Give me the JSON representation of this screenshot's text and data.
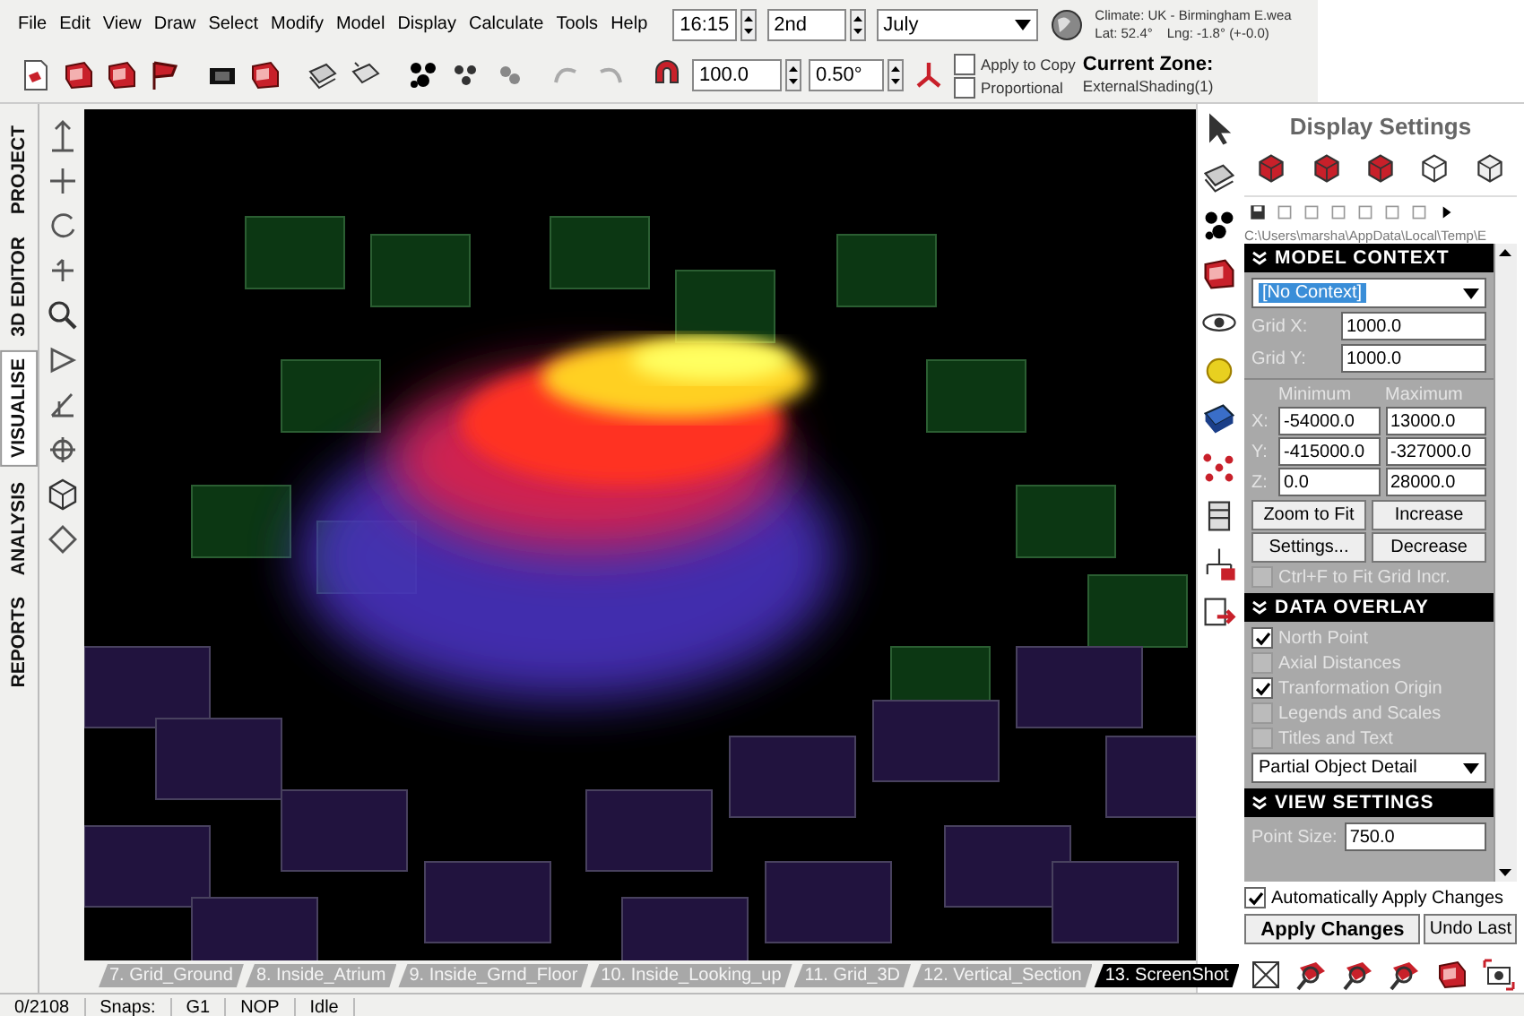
{
  "menu": [
    "File",
    "Edit",
    "View",
    "Draw",
    "Select",
    "Modify",
    "Model",
    "Display",
    "Calculate",
    "Tools",
    "Help"
  ],
  "date_controls": {
    "time": "16:15",
    "day": "2nd",
    "month": "July"
  },
  "climate": {
    "location": "Climate: UK - Birmingham E.wea",
    "lat": "Lat: 52.4°",
    "lng": "Lng: -1.8° (+-0.0)"
  },
  "toolbar": {
    "scale": "100.0",
    "angle": "0.50°",
    "options": [
      {
        "label": "Apply to Copy",
        "checked": false
      },
      {
        "label": "Proportional",
        "checked": false
      }
    ],
    "zone_label": "Current Zone:",
    "zone_value": "ExternalShading(1)"
  },
  "side_tabs": [
    {
      "label": "PROJECT",
      "selected": false
    },
    {
      "label": "3D EDITOR",
      "selected": false
    },
    {
      "label": "VISUALISE",
      "selected": true
    },
    {
      "label": "ANALYSIS",
      "selected": false
    },
    {
      "label": "REPORTS",
      "selected": false
    }
  ],
  "scene_tabs": [
    {
      "label": "7. Grid_Ground",
      "selected": false
    },
    {
      "label": "8. Inside_Atrium",
      "selected": false
    },
    {
      "label": "9. Inside_Grnd_Floor",
      "selected": false
    },
    {
      "label": "10. Inside_Looking_up",
      "selected": false
    },
    {
      "label": "11. Grid_3D",
      "selected": false
    },
    {
      "label": "12. Vertical_Section",
      "selected": false
    },
    {
      "label": "13. ScreenShot",
      "selected": true
    }
  ],
  "display_settings": {
    "title": "Display Settings",
    "path": "C:\\Users\\marsha\\AppData\\Local\\Temp\\E",
    "model_context": {
      "heading": "MODEL CONTEXT",
      "context": "[No Context]",
      "grid": [
        {
          "label": "Grid X:",
          "value": "1000.0"
        },
        {
          "label": "Grid Y:",
          "value": "1000.0"
        }
      ],
      "min_label": "Minimum",
      "max_label": "Maximum",
      "ranges": [
        {
          "axis": "X:",
          "min": "-54000.0",
          "max": "13000.0"
        },
        {
          "axis": "Y:",
          "min": "-415000.0",
          "max": "-327000.0"
        },
        {
          "axis": "Z:",
          "min": "0.0",
          "max": "28000.0"
        }
      ],
      "buttons": [
        "Zoom to Fit",
        "Increase",
        "Settings...",
        "Decrease"
      ],
      "fit_option": {
        "label": "Ctrl+F to Fit Grid Incr.",
        "checked": false
      }
    },
    "data_overlay": {
      "heading": "DATA OVERLAY",
      "options": [
        {
          "label": "North Point",
          "checked": true
        },
        {
          "label": "Axial Distances",
          "checked": false
        },
        {
          "label": "Tranformation Origin",
          "checked": true
        },
        {
          "label": "Legends and Scales",
          "checked": false
        },
        {
          "label": "Titles and Text",
          "checked": false
        }
      ],
      "detail": "Partial Object Detail"
    },
    "view_settings": {
      "heading": "VIEW SETTINGS",
      "point_size_label": "Point Size:",
      "point_size": "750.0"
    },
    "auto_apply": {
      "label": "Automatically Apply Changes",
      "checked": true
    },
    "buttons": [
      "Apply Changes",
      "Undo Last"
    ]
  },
  "status_bar": [
    "0/2108",
    "Snaps:",
    "G1",
    "NOP",
    "Idle"
  ]
}
